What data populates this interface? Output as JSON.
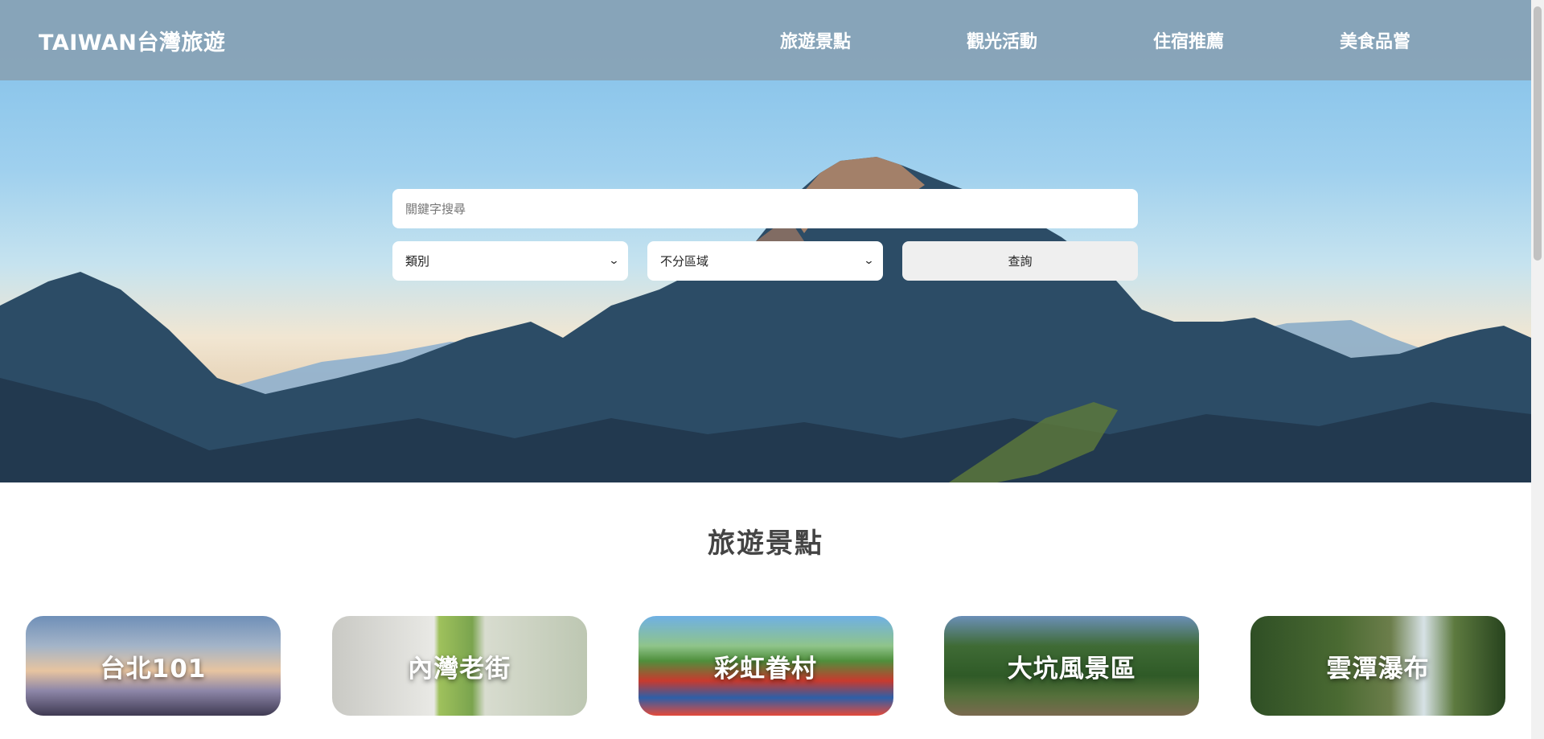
{
  "header": {
    "logo": "TAIWAN台灣旅遊",
    "nav": [
      "旅遊景點",
      "觀光活動",
      "住宿推薦",
      "美食品嘗"
    ]
  },
  "search": {
    "placeholder": "關鍵字搜尋",
    "category_selected": "類別",
    "region_selected": "不分區域",
    "submit_label": "查詢"
  },
  "section": {
    "title": "旅遊景點",
    "cards": [
      "台北101",
      "內灣老街",
      "彩虹眷村",
      "大坑風景區",
      "雲潭瀑布"
    ]
  },
  "icons": {
    "select_arrow": "chevron-down-icon"
  }
}
